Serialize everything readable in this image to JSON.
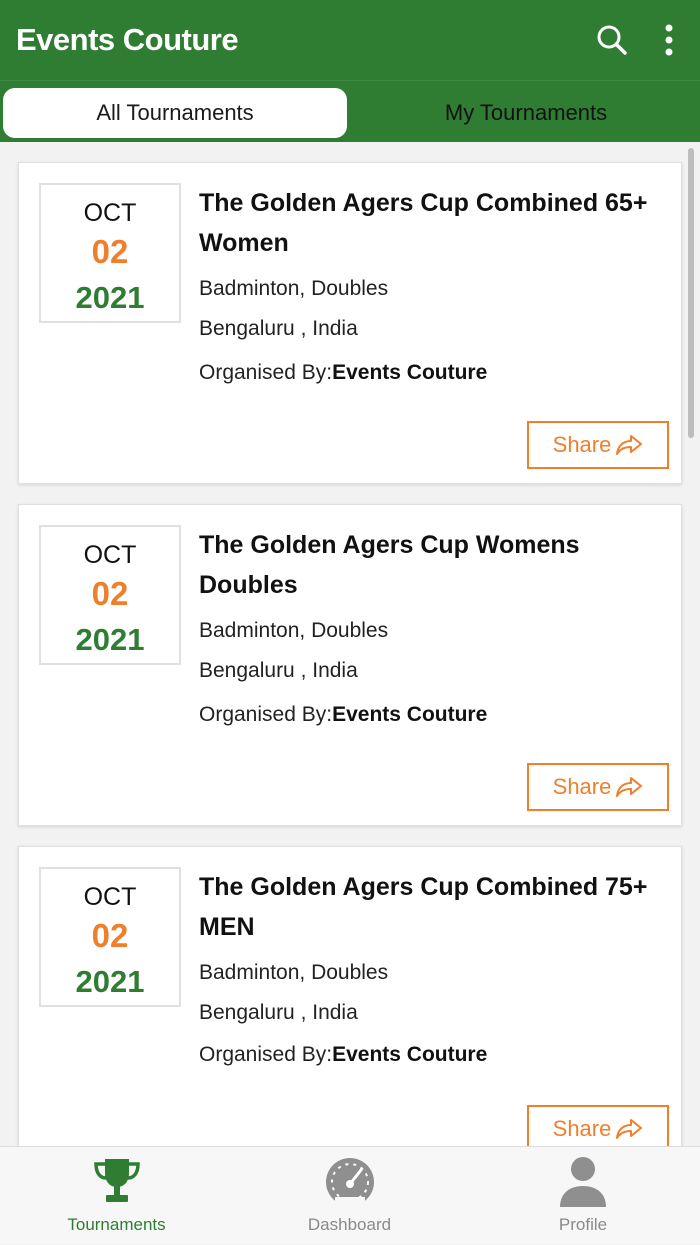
{
  "header": {
    "title": "Events Couture",
    "search_icon": "search-icon",
    "menu_icon": "more-vert-icon"
  },
  "tabs": [
    {
      "label": "All Tournaments",
      "active": true
    },
    {
      "label": "My Tournaments",
      "active": false
    }
  ],
  "tournaments": [
    {
      "month": "OCT",
      "day": "02",
      "year": "2021",
      "title": "The Golden Agers Cup Combined 65+ Women",
      "sport": "Badminton, Doubles",
      "location": "Bengaluru , India",
      "organised_label": "Organised By:",
      "organiser": "Events Couture",
      "share_label": "Share"
    },
    {
      "month": "OCT",
      "day": "02",
      "year": "2021",
      "title": "The Golden Agers Cup Womens Doubles",
      "sport": "Badminton, Doubles",
      "location": "Bengaluru , India",
      "organised_label": "Organised By:",
      "organiser": "Events Couture",
      "share_label": "Share"
    },
    {
      "month": "OCT",
      "day": "02",
      "year": "2021",
      "title": "The Golden Agers Cup Combined 75+ MEN",
      "sport": "Badminton, Doubles",
      "location": "Bengaluru , India",
      "organised_label": "Organised By:",
      "organiser": "Events Couture",
      "share_label": "Share"
    }
  ],
  "bottom_nav": [
    {
      "label": "Tournaments",
      "icon": "trophy-icon",
      "active": true
    },
    {
      "label": "Dashboard",
      "icon": "speedometer-icon",
      "active": false
    },
    {
      "label": "Profile",
      "icon": "person-icon",
      "active": false
    }
  ],
  "colors": {
    "primary": "#2e7d32",
    "accent": "#f07f2c"
  }
}
